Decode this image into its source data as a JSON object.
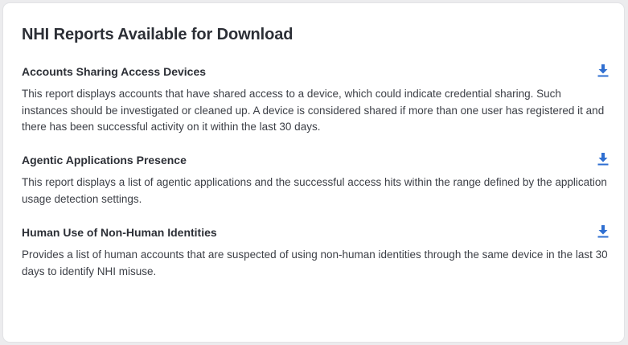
{
  "panel": {
    "title": "NHI Reports Available for Download"
  },
  "reports": [
    {
      "title": "Accounts Sharing Access Devices",
      "description": "This report displays accounts that have shared access to a device, which could indicate credential sharing. Such instances should be investigated or cleaned up. A device is considered shared if more than one user has registered it and there has been successful activity on it within the last 30 days.",
      "icon": "download-icon"
    },
    {
      "title": "Agentic Applications Presence",
      "description": "This report displays a list of agentic applications and the successful access hits within the range defined by the application usage detection settings.",
      "icon": "download-icon"
    },
    {
      "title": "Human Use of Non-Human Identities",
      "description": "Provides a list of human accounts that are suspected of using non-human identities through the same device in the last 30 days to identify NHI misuse.",
      "icon": "download-icon"
    }
  ],
  "colors": {
    "accent": "#2f6fd1",
    "title": "#2c2f36",
    "text": "#3d4047",
    "card": "#ffffff",
    "background": "#ececee"
  }
}
